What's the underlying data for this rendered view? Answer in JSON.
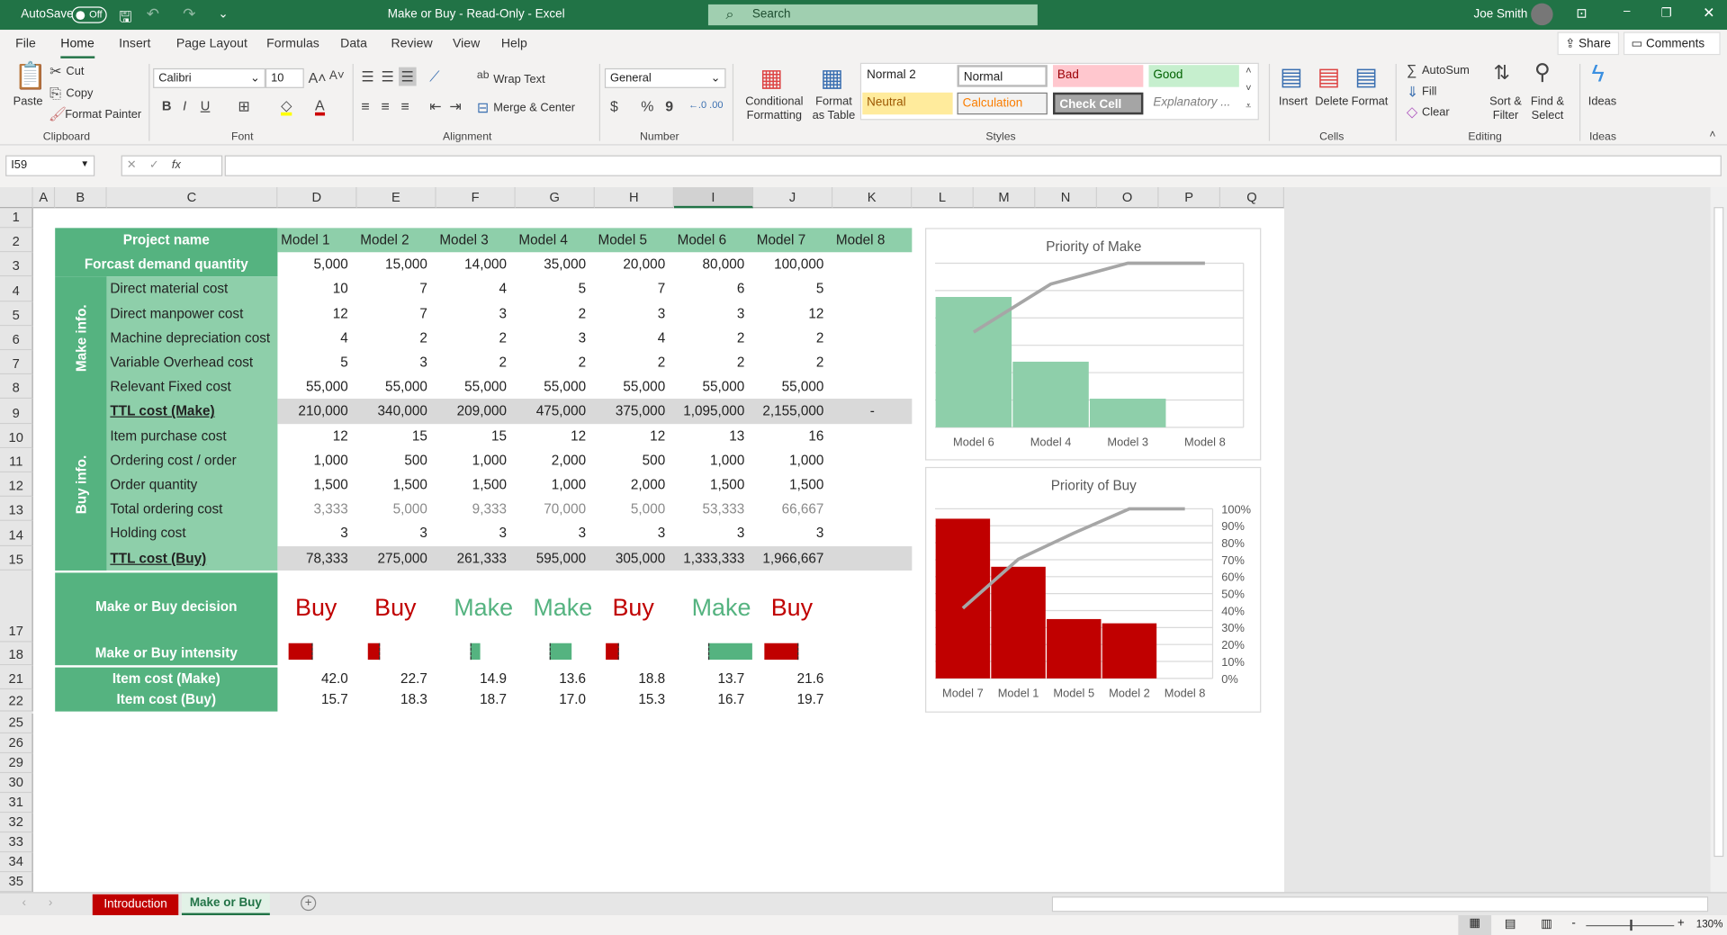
{
  "titlebar": {
    "autosave_label": "AutoSave",
    "autosave_state": "Off",
    "title": "Make or Buy  -  Read-Only  -  Excel",
    "search_placeholder": "Search",
    "user": "Joe Smith"
  },
  "ribbon_tabs": [
    "File",
    "Home",
    "Insert",
    "Page Layout",
    "Formulas",
    "Data",
    "Review",
    "View",
    "Help"
  ],
  "share": "Share",
  "comments": "Comments",
  "clipboard": {
    "paste": "Paste",
    "cut": "Cut",
    "copy": "Copy",
    "format_painter": "Format Painter",
    "group": "Clipboard"
  },
  "font": {
    "name": "Calibri",
    "size": "10",
    "bold": "B",
    "italic": "I",
    "underline": "U",
    "group": "Font"
  },
  "alignment": {
    "wrap": "Wrap Text",
    "merge": "Merge & Center",
    "group": "Alignment"
  },
  "number": {
    "format": "General",
    "currency": "$",
    "percent": "%",
    "comma": "9",
    "group": "Number"
  },
  "styles": {
    "conditional": "Conditional Formatting",
    "format_table": "Format as Table",
    "items": [
      "Normal 2",
      "Normal",
      "Bad",
      "Good",
      "Neutral",
      "Calculation",
      "Check Cell",
      "Explanatory ..."
    ],
    "group": "Styles"
  },
  "cells": {
    "insert": "Insert",
    "delete": "Delete",
    "format": "Format",
    "group": "Cells"
  },
  "editing": {
    "autosum": "AutoSum",
    "fill": "Fill",
    "clear": "Clear",
    "sort": "Sort & Filter",
    "find": "Find & Select",
    "group": "Editing"
  },
  "ideas": {
    "label": "Ideas",
    "group": "Ideas"
  },
  "formula_bar": {
    "name_box": "I59",
    "fx": "fx",
    "formula": ""
  },
  "columns": [
    "A",
    "B",
    "C",
    "D",
    "E",
    "F",
    "G",
    "H",
    "I",
    "J",
    "K",
    "L",
    "M",
    "N",
    "O",
    "P",
    "Q"
  ],
  "row_numbers": [
    "1",
    "2",
    "3",
    "4",
    "5",
    "6",
    "7",
    "8",
    "9",
    "10",
    "11",
    "12",
    "13",
    "14",
    "15",
    "17",
    "18",
    "21",
    "22",
    "25",
    "26",
    "29",
    "30",
    "31",
    "32",
    "33",
    "34",
    "35"
  ],
  "table": {
    "project_label": "Project name",
    "models": [
      "Model 1",
      "Model 2",
      "Model 3",
      "Model 4",
      "Model 5",
      "Model 6",
      "Model 7",
      "Model 8"
    ],
    "demand_label": "Forcast demand quantity",
    "demand": [
      "5,000",
      "15,000",
      "14,000",
      "35,000",
      "20,000",
      "80,000",
      "100,000",
      ""
    ],
    "make_group": "Make info.",
    "buy_group": "Buy info.",
    "rows": [
      {
        "label": "Direct material cost",
        "values": [
          "10",
          "7",
          "4",
          "5",
          "7",
          "6",
          "5",
          ""
        ]
      },
      {
        "label": "Direct manpower cost",
        "values": [
          "12",
          "7",
          "3",
          "2",
          "3",
          "3",
          "12",
          ""
        ]
      },
      {
        "label": "Machine depreciation cost",
        "values": [
          "4",
          "2",
          "2",
          "3",
          "4",
          "2",
          "2",
          ""
        ]
      },
      {
        "label": "Variable Overhead cost",
        "values": [
          "5",
          "3",
          "2",
          "2",
          "2",
          "2",
          "2",
          ""
        ]
      },
      {
        "label": "Relevant Fixed cost",
        "values": [
          "55,000",
          "55,000",
          "55,000",
          "55,000",
          "55,000",
          "55,000",
          "55,000",
          ""
        ]
      },
      {
        "label": "TTL cost (Make)",
        "values": [
          "210,000",
          "340,000",
          "209,000",
          "475,000",
          "375,000",
          "1,095,000",
          "2,155,000",
          "-"
        ],
        "total": true
      },
      {
        "label": "Item purchase cost",
        "values": [
          "12",
          "15",
          "15",
          "12",
          "12",
          "13",
          "16",
          ""
        ]
      },
      {
        "label": "Ordering cost / order",
        "values": [
          "1,000",
          "500",
          "1,000",
          "2,000",
          "500",
          "1,000",
          "1,000",
          ""
        ]
      },
      {
        "label": "Order quantity",
        "values": [
          "1,500",
          "1,500",
          "1,500",
          "1,000",
          "2,000",
          "1,500",
          "1,500",
          ""
        ]
      },
      {
        "label": "Total ordering cost",
        "values": [
          "3,333",
          "5,000",
          "9,333",
          "70,000",
          "5,000",
          "53,333",
          "66,667",
          ""
        ],
        "muted": true
      },
      {
        "label": "Holding cost",
        "values": [
          "3",
          "3",
          "3",
          "3",
          "3",
          "3",
          "3",
          ""
        ]
      },
      {
        "label": "TTL cost (Buy)",
        "values": [
          "78,333",
          "275,000",
          "261,333",
          "595,000",
          "305,000",
          "1,333,333",
          "1,966,667",
          ""
        ],
        "total": true
      }
    ],
    "decision_label": "Make or Buy decision",
    "decisions": [
      "Buy",
      "Buy",
      "Make",
      "Make",
      "Buy",
      "Make",
      "Buy"
    ],
    "intensity_label": "Make or Buy intensity",
    "intensity": [
      131667,
      65000,
      52333,
      120000,
      70000,
      238333,
      188333
    ],
    "item_make_label": "Item cost (Make)",
    "item_make": [
      "42.0",
      "22.7",
      "14.9",
      "13.6",
      "18.8",
      "13.7",
      "21.6"
    ],
    "item_buy_label": "Item cost (Buy)",
    "item_buy": [
      "15.7",
      "18.3",
      "18.7",
      "17.0",
      "15.3",
      "16.7",
      "19.7"
    ]
  },
  "colors": {
    "dark_green": "#55b380",
    "light_green": "#8ecfaa",
    "buy_red": "#c00000",
    "make_green": "#55b380",
    "total_grey": "#d9d9d9",
    "excel_green": "#217346"
  },
  "chart_data": [
    {
      "type": "bar",
      "title": "Priority of Make",
      "categories": [
        "Model 6",
        "Model 4",
        "Model 3",
        "Model 8"
      ],
      "values": [
        238333,
        120000,
        52333,
        0
      ],
      "ylim": [
        0,
        300000
      ],
      "cumulative_percent": [
        58,
        87.3,
        100,
        100
      ],
      "bar_color": "#8ecfaa",
      "line_color": "#a6a6a6",
      "secondary_axis_visible": false
    },
    {
      "type": "bar",
      "title": "Priority of Buy",
      "categories": [
        "Model 7",
        "Model 1",
        "Model 5",
        "Model 2",
        "Model 8"
      ],
      "values": [
        188333,
        131667,
        70000,
        65000,
        0
      ],
      "ylim": [
        0,
        200000
      ],
      "cumulative_percent": [
        41.4,
        70.3,
        85.7,
        100,
        100
      ],
      "bar_color": "#c00000",
      "line_color": "#a6a6a6",
      "secondary_axis_visible": true,
      "secondary_ticks": [
        "100%",
        "90%",
        "80%",
        "70%",
        "60%",
        "50%",
        "40%",
        "30%",
        "20%",
        "10%",
        "0%"
      ]
    }
  ],
  "sheet_tabs": [
    {
      "label": "Introduction",
      "color": "#c00000",
      "active": false
    },
    {
      "label": "Make or Buy",
      "color": "#217346",
      "active": true
    }
  ],
  "status": {
    "zoom": "130%"
  }
}
